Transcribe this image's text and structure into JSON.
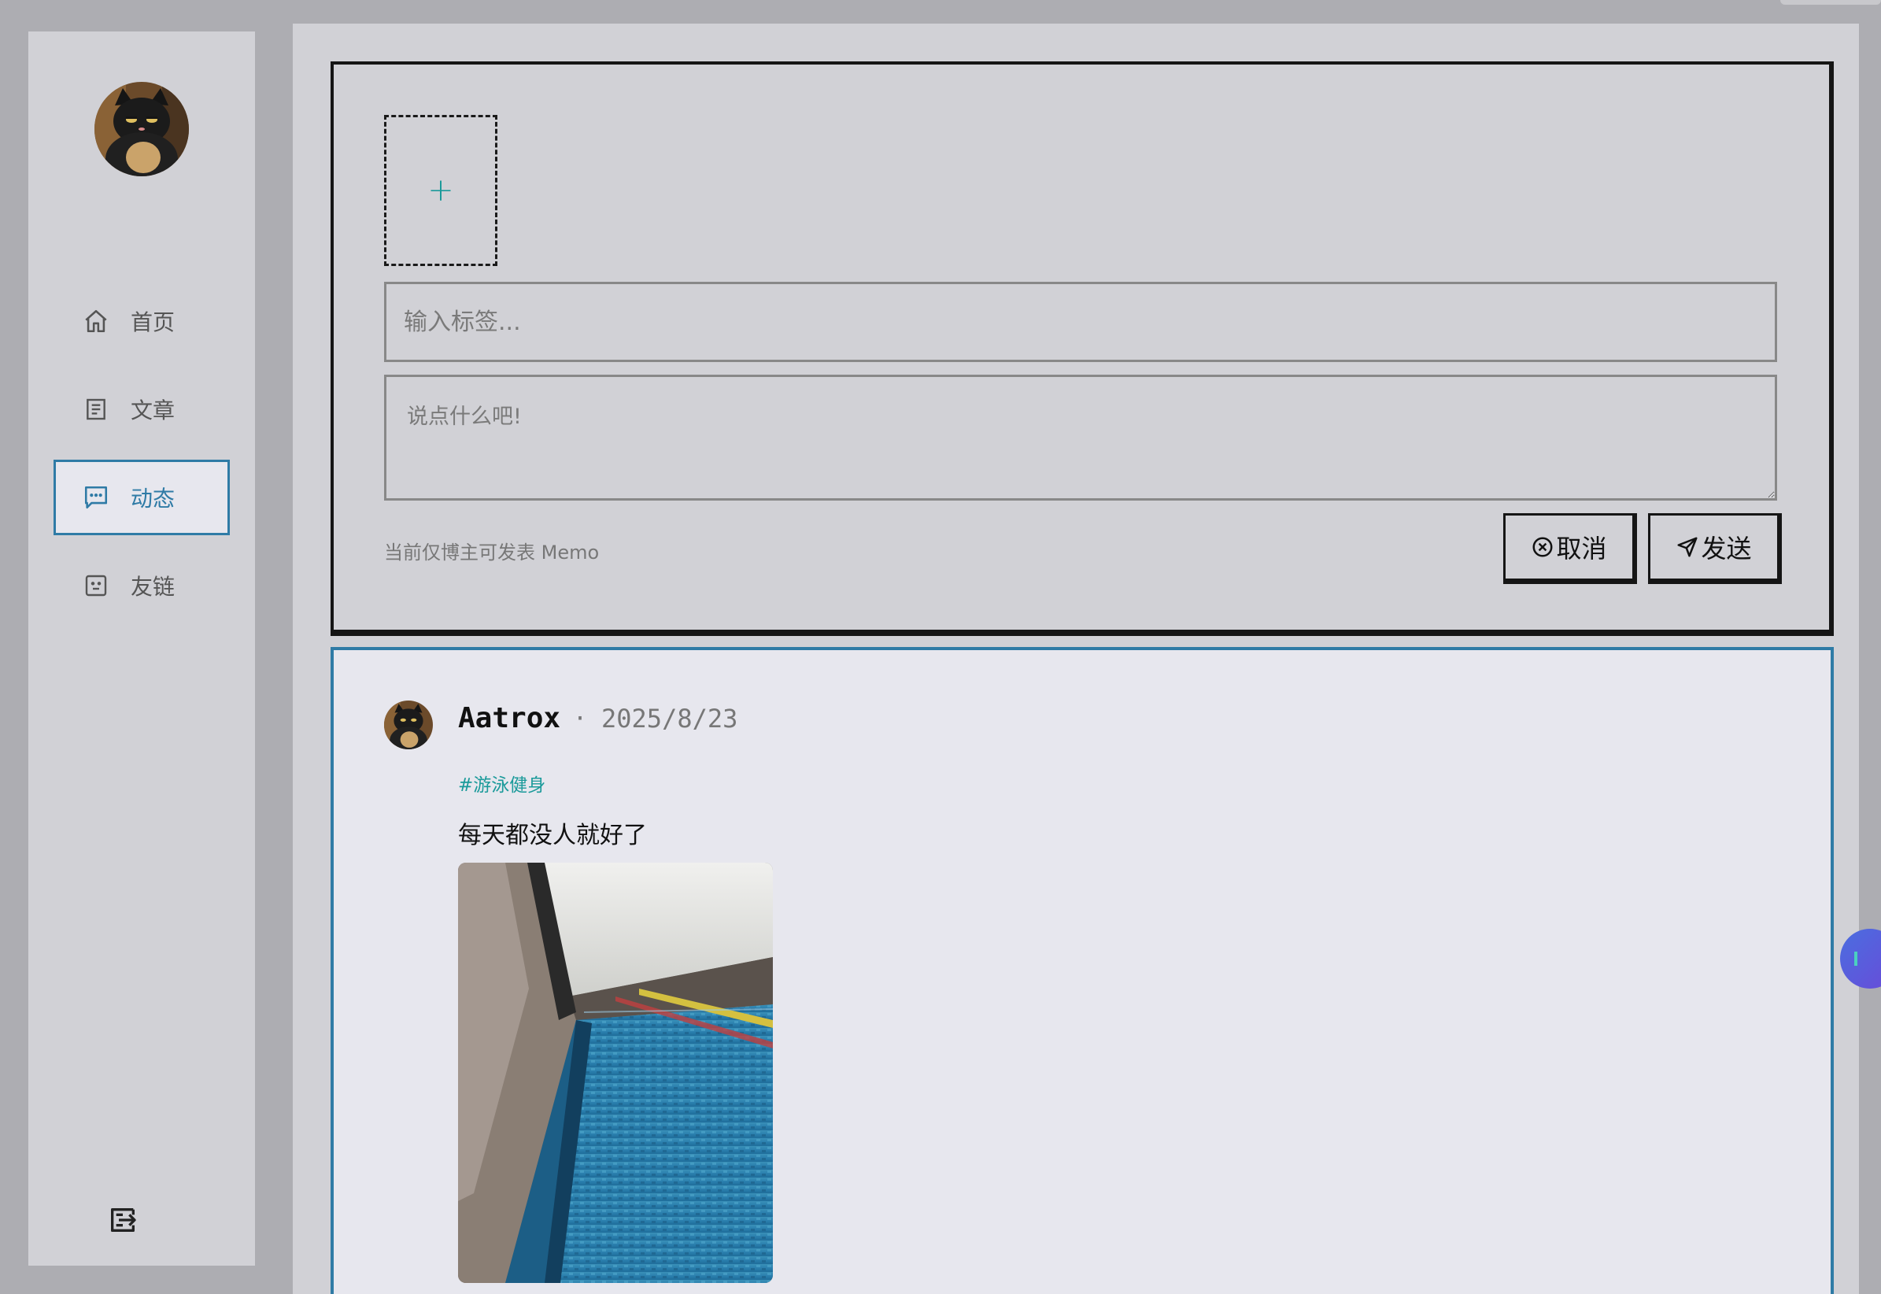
{
  "sidebar": {
    "items": [
      {
        "label": "首页",
        "icon": "home-icon"
      },
      {
        "label": "文章",
        "icon": "article-icon"
      },
      {
        "label": "动态",
        "icon": "chat-icon"
      },
      {
        "label": "友链",
        "icon": "friend-link-icon"
      }
    ],
    "active_index": 2,
    "logout_icon": "logout-icon"
  },
  "editor": {
    "upload_symbol": "+",
    "tag_placeholder": "输入标签...",
    "memo_placeholder": "说点什么吧!",
    "hint": "当前仅博主可发表 Memo",
    "cancel_label": "取消",
    "send_label": "发送"
  },
  "memo": {
    "author": "Aatrox",
    "separator": "·",
    "date": "2025/8/23",
    "tag": "#游泳健身",
    "content": "每天都没人就好了"
  },
  "colors": {
    "accent": "#2f7ba6",
    "tag": "#1a9a9a",
    "background": "#d1d1d6",
    "card": "#e7e7ee"
  }
}
